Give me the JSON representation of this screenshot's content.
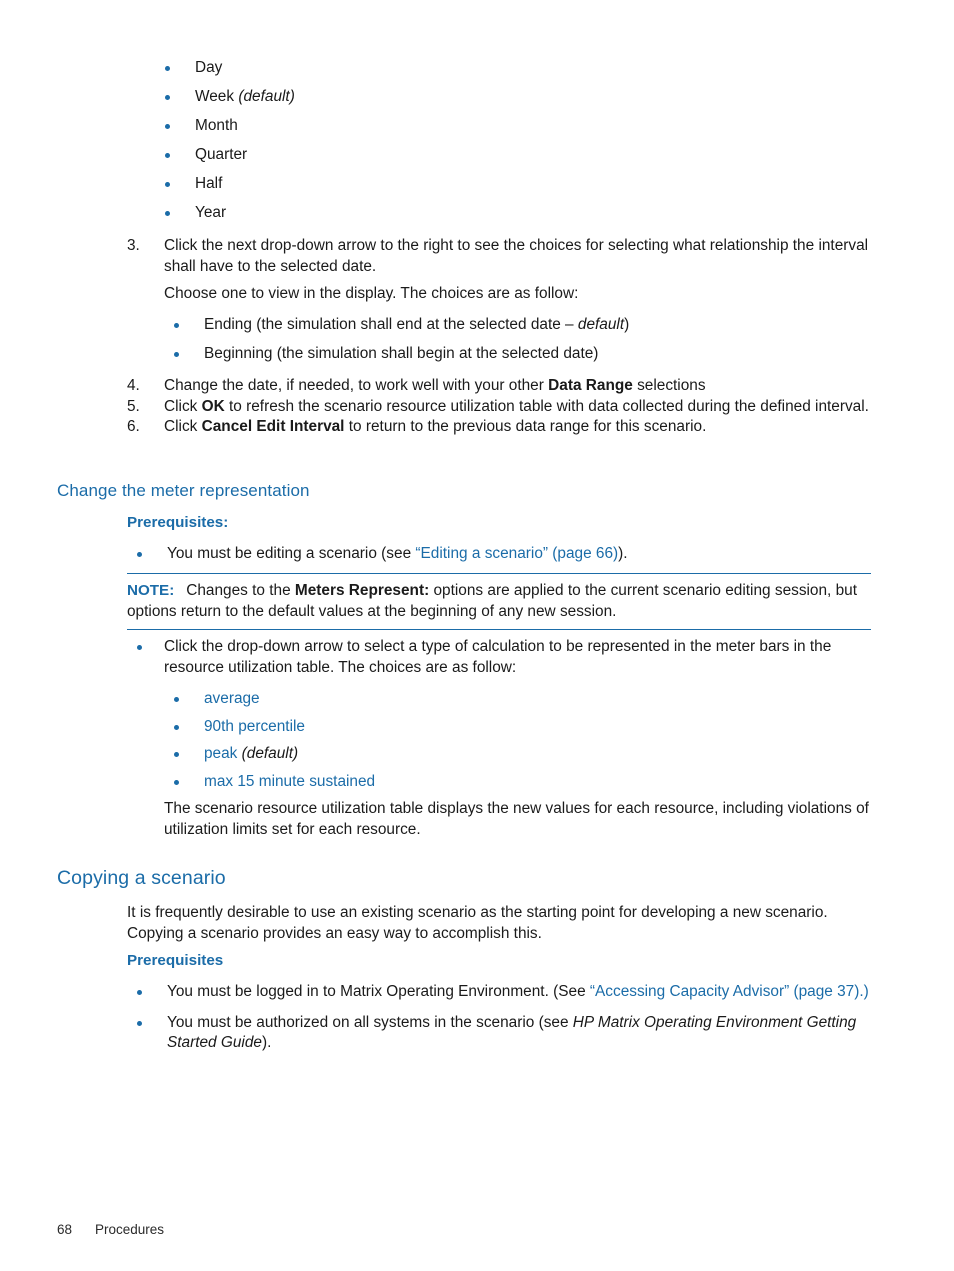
{
  "page": {
    "footer_page_number": "68",
    "footer_chapter": "Procedures"
  },
  "interval_choices": {
    "items": [
      {
        "label": "Day",
        "note": ""
      },
      {
        "label": "Week",
        "note": "(default)"
      },
      {
        "label": "Month",
        "note": ""
      },
      {
        "label": "Quarter",
        "note": ""
      },
      {
        "label": "Half",
        "note": ""
      },
      {
        "label": "Year",
        "note": ""
      }
    ]
  },
  "steps": {
    "step3": {
      "number": "3.",
      "text": "Click the next drop-down arrow to the right to see the choices for selecting what relationship the interval shall have to the selected date.",
      "follow_on": "Choose one to view in the display. The choices are as follow:",
      "choices": [
        {
          "pre": "Ending (the simulation shall end at the selected date – ",
          "ital": "default",
          "post": ")"
        },
        {
          "pre": "Beginning (the simulation shall begin at the selected date)",
          "ital": "",
          "post": ""
        }
      ]
    },
    "step4": {
      "number": "4.",
      "pre": "Change the date, if needed, to work well with your other ",
      "bold": "Data Range",
      "post": " selections"
    },
    "step5": {
      "number": "5.",
      "pre": "Click ",
      "bold": "OK",
      "post": " to refresh the scenario resource utilization table with data collected during the defined interval."
    },
    "step6": {
      "number": "6.",
      "pre": "Click ",
      "bold": "Cancel Edit Interval",
      "post": " to return to the previous data range for this scenario."
    }
  },
  "change_meter": {
    "heading": "Change the meter representation",
    "prerequisites_heading": "Prerequisites:",
    "prerequisite_item": {
      "pre": "You must be editing a scenario (see ",
      "link": "“Editing a scenario” (page 66)",
      "post": ")."
    },
    "note": {
      "label": "NOTE:",
      "pre": "Changes to the ",
      "bold": "Meters Represent:",
      "post": " options are applied to the current scenario editing session, but options return to the default values at the beginning of any new session."
    },
    "instruction": "Click the drop-down arrow to select a type of calculation to be represented in the meter bars in the resource utilization table. The choices are as follow:",
    "calculation_choices": [
      {
        "label": "average",
        "note": ""
      },
      {
        "label": "90th percentile",
        "note": ""
      },
      {
        "label": "peak",
        "note": "(default)"
      },
      {
        "label": "max 15 minute sustained",
        "note": ""
      }
    ],
    "result_text": "The scenario resource utilization table displays the new values for each resource, including violations of utilization limits set for each resource."
  },
  "copying_scenario": {
    "heading": "Copying a scenario",
    "intro": "It is frequently desirable to use an existing scenario as the starting point for developing a new scenario. Copying a scenario provides an easy way to accomplish this.",
    "prerequisites_heading": "Prerequisites",
    "prerequisites": [
      {
        "pre": "You must be logged in to Matrix Operating Environment. (See ",
        "link": "“Accessing Capacity Advisor” (page 37)",
        "post": ".)"
      },
      {
        "pre": "You must be authorized on all systems in the scenario (see ",
        "ital": "HP Matrix Operating Environment Getting Started Guide",
        "post": ")."
      }
    ]
  },
  "colors": {
    "accent_blue": "#1b6ca8",
    "body_text": "#1b1b1b"
  }
}
